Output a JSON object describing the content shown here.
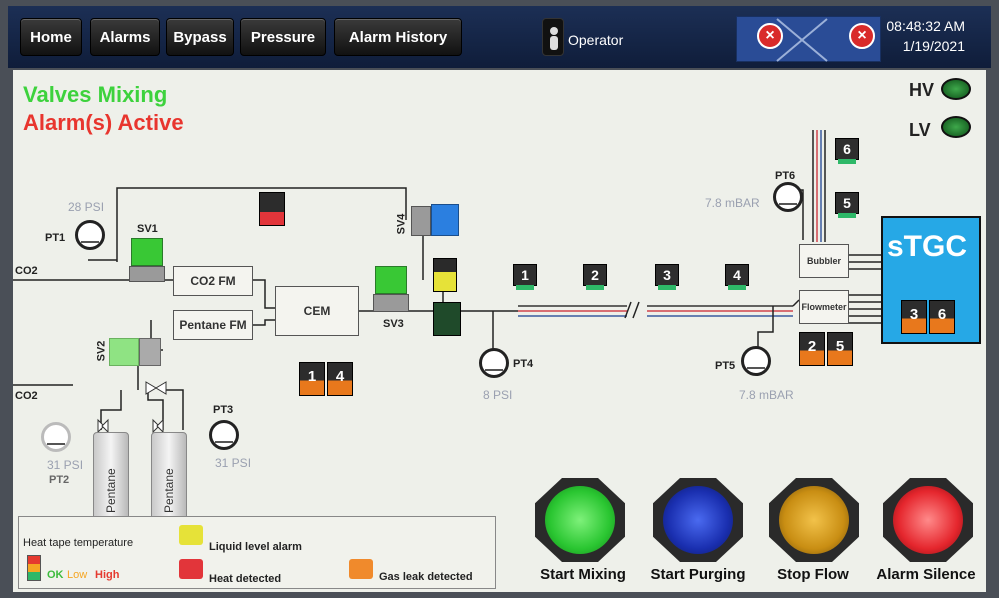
{
  "nav": {
    "home": "Home",
    "alarms": "Alarms",
    "bypass": "Bypass",
    "pressure": "Pressure",
    "alarm_history": "Alarm History"
  },
  "user": {
    "role": "Operator"
  },
  "clock": {
    "time": "08:48:32 AM",
    "date": "1/19/2021"
  },
  "status": {
    "mode": "Valves Mixing",
    "alarm": "Alarm(s) Active",
    "mode_color": "#3dd23d",
    "alarm_color": "#e8352e"
  },
  "indicators": {
    "hv": "HV",
    "lv": "LV"
  },
  "labels": {
    "co2_top": "CO2",
    "co2_bottom": "CO2",
    "pt1": "PT1",
    "pt1_value": "28 PSI",
    "pt2": "PT2",
    "pt2_value": "31 PSI",
    "pt3": "PT3",
    "pt3_value": "31 PSI",
    "pt4": "PT4",
    "pt4_value": "8 PSI",
    "pt5": "PT5",
    "pt5_value": "7.8 mBAR",
    "pt6": "PT6",
    "pt6_value": "7.8 mBAR",
    "sv1": "SV1",
    "sv2": "SV2",
    "sv3": "SV3",
    "sv4": "SV4",
    "co2_fm": "CO2 FM",
    "pentane_fm": "Pentane FM",
    "cem": "CEM",
    "bubbler": "Bubbler",
    "flowmeter": "Flowmeter",
    "stgc": "sTGC",
    "pentane_tank": "Pentane"
  },
  "chips": [
    "1",
    "2",
    "3",
    "4",
    "5",
    "6"
  ],
  "pairs": {
    "left_a": "1",
    "left_b": "4",
    "right_a": "2",
    "right_b": "5",
    "stgc_a": "3",
    "stgc_b": "6"
  },
  "legend": {
    "heat_tape": "Heat tape temperature",
    "ok": "OK",
    "low": "Low",
    "high": "High",
    "liquid_level": "Liquid level alarm",
    "heat_detected": "Heat detected",
    "gas_leak": "Gas leak detected"
  },
  "buttons": {
    "start_mixing": "Start Mixing",
    "start_purging": "Start Purging",
    "stop_flow": "Stop Flow",
    "alarm_silence": "Alarm Silence"
  },
  "icons": {
    "alarm_x": "×"
  }
}
